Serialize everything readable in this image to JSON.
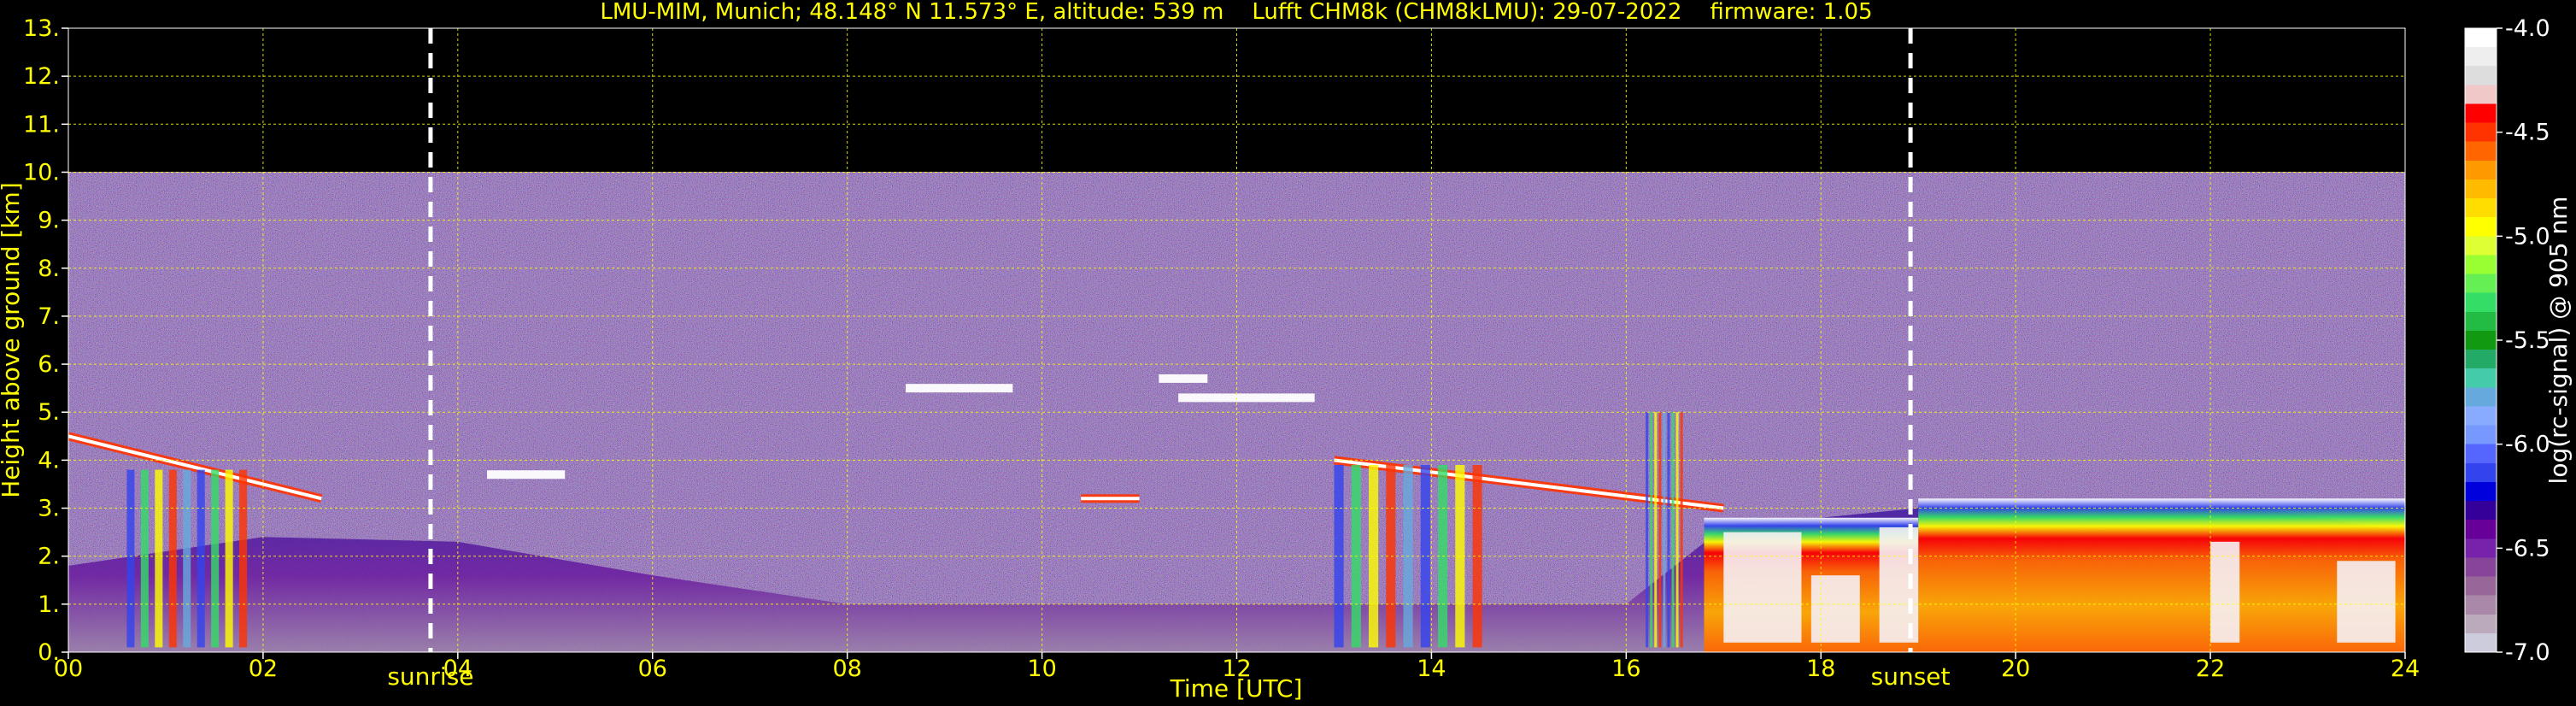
{
  "chart_data": {
    "type": "heatmap",
    "title": "LMU-MIM, Munich; 48.148° N 11.573° E, altitude: 539 m    Lufft CHM8k (CHM8kLMU): 29-07-2022    firmware: 1.05",
    "xlabel": "Time [UTC]",
    "ylabel": "Height above ground [km]",
    "xlim": [
      0,
      24
    ],
    "ylim": [
      0,
      13
    ],
    "x_ticks": [
      "00",
      "02",
      "04",
      "06",
      "08",
      "10",
      "12",
      "14",
      "16",
      "18",
      "20",
      "22",
      "24"
    ],
    "y_ticks": [
      "0.",
      "1.",
      "2.",
      "3.",
      "4.",
      "5.",
      "6.",
      "7.",
      "8.",
      "9.",
      "10.",
      "11.",
      "12.",
      "13."
    ],
    "grid": true,
    "annotations": [
      {
        "label": "sunrise",
        "x": 3.72
      },
      {
        "label": "sunset",
        "x": 18.92
      }
    ],
    "colorbar": {
      "label": "log(rc-signal) @ 905 nm",
      "range": [
        -7.0,
        -4.0
      ],
      "ticks": [
        "-4.0",
        "-4.5",
        "-5.0",
        "-5.5",
        "-6.0",
        "-6.5",
        "-7.0"
      ],
      "colors": [
        "#ffffff",
        "#eeeeee",
        "#dddddd",
        "#f0c8c8",
        "#ff0000",
        "#ff3300",
        "#ff6600",
        "#ff9900",
        "#ffbb00",
        "#ffdd00",
        "#ffff00",
        "#ddff33",
        "#99ff33",
        "#66ee55",
        "#33dd66",
        "#22bb44",
        "#119911",
        "#22aa66",
        "#44ccaa",
        "#66aadd",
        "#88aaff",
        "#7799ff",
        "#5566ff",
        "#3344ee",
        "#0000dd",
        "#330099",
        "#660099",
        "#7722aa",
        "#884499",
        "#996699",
        "#aa88aa",
        "#bbaabb",
        "#ccccdd"
      ]
    },
    "features": {
      "signal_top_km": 10.0,
      "high_clouds": [
        {
          "t0": 8.6,
          "t1": 9.7,
          "h": 5.5
        },
        {
          "t0": 11.4,
          "t1": 12.8,
          "h": 5.3
        },
        {
          "t0": 4.3,
          "t1": 5.1,
          "h": 3.7
        },
        {
          "t0": 11.2,
          "t1": 11.7,
          "h": 5.7
        }
      ],
      "mid_clouds": [
        {
          "t0": 0.0,
          "t1": 2.6,
          "h0": 4.5,
          "h1": 3.2
        },
        {
          "t0": 10.4,
          "t1": 11.0,
          "h": 3.2
        },
        {
          "t0": 13.0,
          "t1": 17.0,
          "h0": 4.0,
          "h1": 3.0
        }
      ],
      "boundary_layer_top_km": [
        [
          0,
          1.8
        ],
        [
          2,
          2.4
        ],
        [
          4,
          2.3
        ],
        [
          6,
          1.6
        ],
        [
          8,
          1.0
        ],
        [
          12,
          1.0
        ],
        [
          16,
          1.0
        ],
        [
          17,
          2.6
        ],
        [
          19,
          3.0
        ],
        [
          22,
          3.2
        ],
        [
          24,
          2.5
        ]
      ],
      "fallstreaks": [
        {
          "t0": 0.6,
          "t1": 1.9,
          "h": 3.8
        },
        {
          "t0": 13.0,
          "t1": 14.6,
          "h": 3.9
        },
        {
          "t0": 16.2,
          "t1": 16.6,
          "h": 5.0
        }
      ],
      "low_cloud_deck": [
        {
          "t0": 16.8,
          "t1": 19.0,
          "h": 2.8
        },
        {
          "t0": 19.0,
          "t1": 24.0,
          "h": 3.2
        }
      ]
    }
  }
}
